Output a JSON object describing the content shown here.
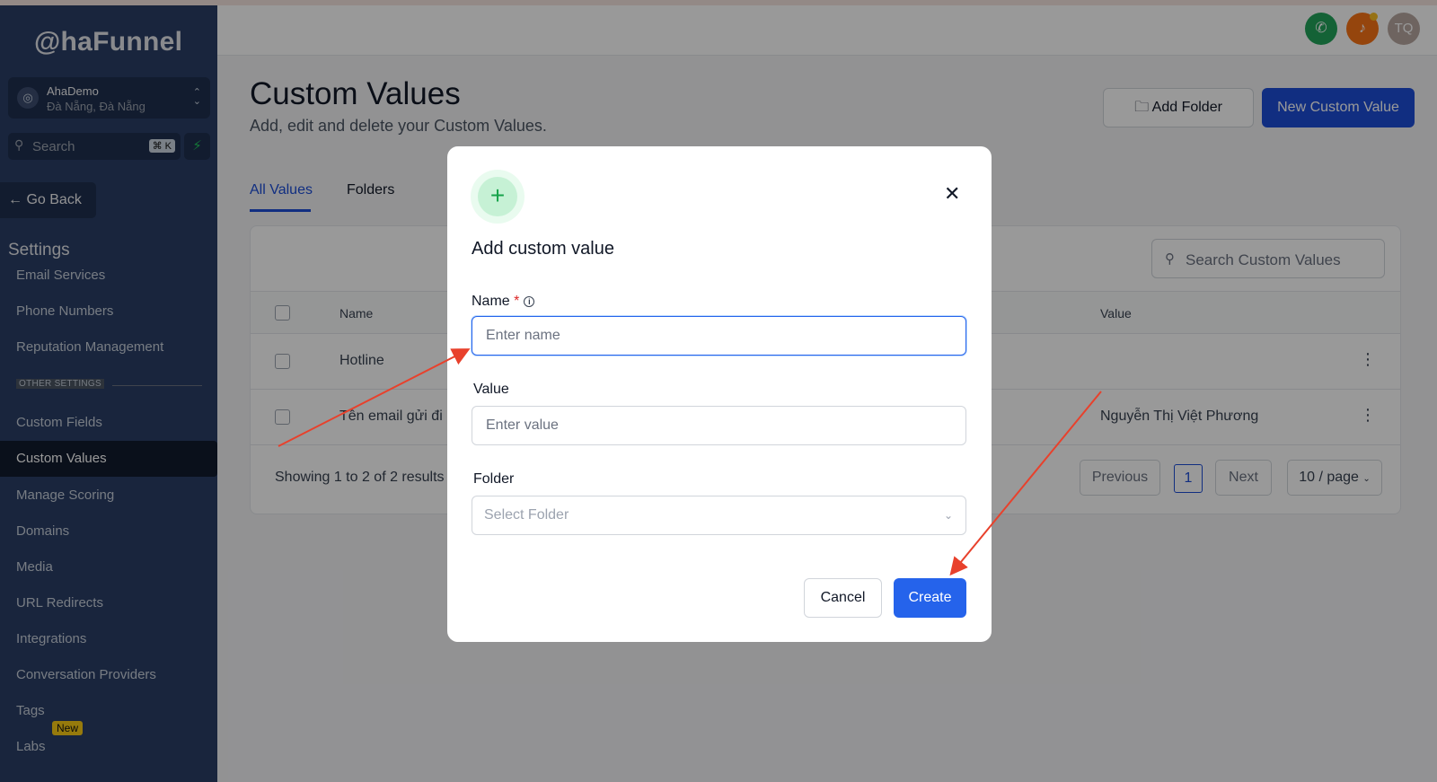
{
  "app": {
    "logo": "@haFunnel",
    "account_name": "AhaDemo",
    "account_location": "Đà Nẵng, Đà Nẵng"
  },
  "sidebar": {
    "search_placeholder": "Search",
    "search_shortcut": "⌘ K",
    "go_back": "Go Back",
    "settings_heading": "Settings",
    "items": [
      {
        "label": "Email Services"
      },
      {
        "label": "Phone Numbers"
      },
      {
        "label": "Reputation Management"
      },
      {
        "label": "Custom Fields"
      },
      {
        "label": "Custom Values"
      },
      {
        "label": "Manage Scoring"
      },
      {
        "label": "Domains"
      },
      {
        "label": "Media"
      },
      {
        "label": "URL Redirects"
      },
      {
        "label": "Integrations"
      },
      {
        "label": "Conversation Providers"
      },
      {
        "label": "Tags"
      },
      {
        "label": "Labs"
      }
    ],
    "other_settings": "OTHER SETTINGS",
    "labs_badge": "New"
  },
  "header": {
    "avatar_initials": "TQ"
  },
  "page": {
    "title": "Custom Values",
    "subtitle": "Add, edit and delete your Custom Values.",
    "add_folder": "Add Folder",
    "new_custom_value": "New Custom Value",
    "tabs": [
      "All Values",
      "Folders"
    ],
    "search_placeholder": "Search Custom Values",
    "columns": {
      "name": "Name",
      "value": "Value"
    },
    "rows": [
      {
        "name": "Hotline",
        "value": ""
      },
      {
        "name": "Tên email gửi đi",
        "value": "Nguyễn Thị Việt Phương"
      }
    ],
    "showing": "Showing 1 to 2 of 2 results",
    "previous": "Previous",
    "current_page": "1",
    "next": "Next",
    "per_page": "10 / page"
  },
  "modal": {
    "title": "Add custom value",
    "name_label": "Name",
    "name_required": "*",
    "name_placeholder": "Enter name",
    "value_label": "Value",
    "value_placeholder": "Enter value",
    "folder_label": "Folder",
    "folder_placeholder": "Select Folder",
    "cancel": "Cancel",
    "create": "Create"
  },
  "colors": {
    "sidebar_bg": "#2b3f66",
    "primary": "#1d4ed8",
    "create_button": "#2563eb",
    "annotation_arrow": "#e8412c"
  }
}
